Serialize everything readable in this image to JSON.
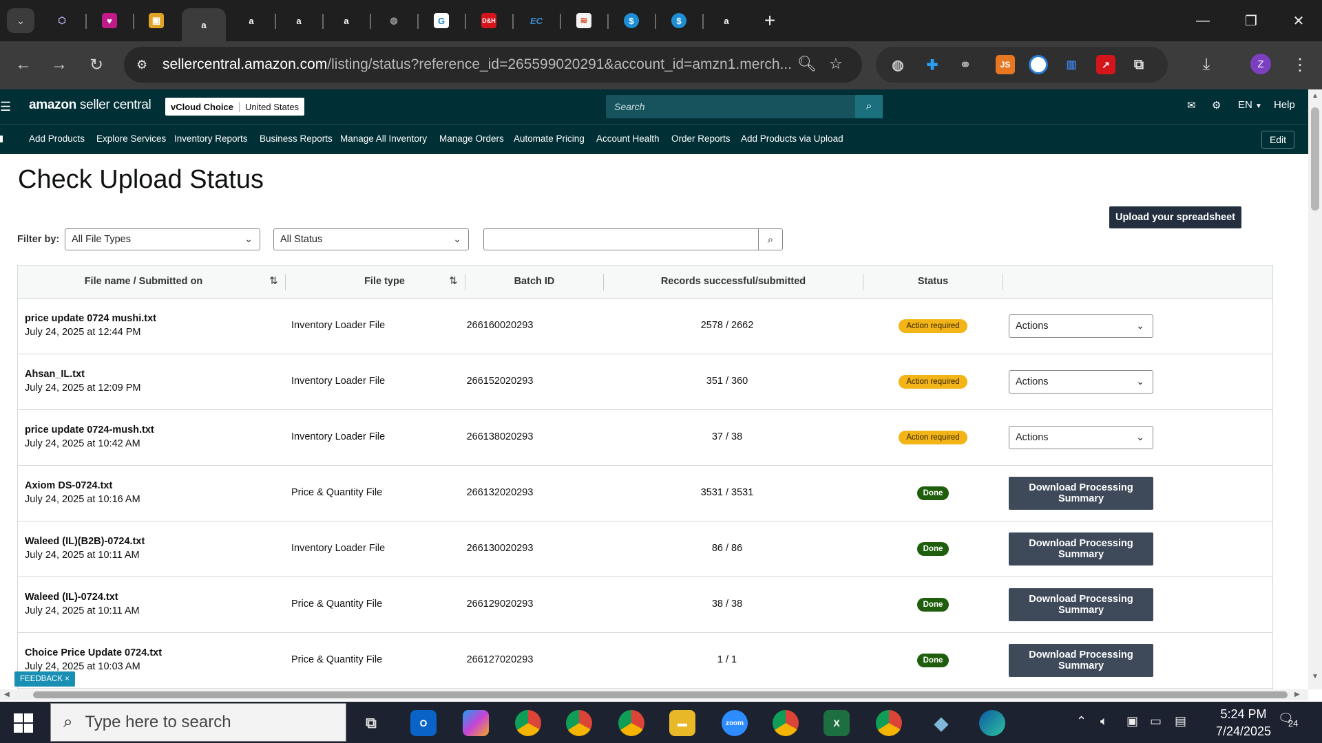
{
  "browser": {
    "url_host": "sellercentral.amazon.com",
    "url_rest": "/listing/status?reference_id=265599020291&account_id=amzn1.merch...",
    "profile_initial": "Z"
  },
  "header": {
    "logo_bold": "amazon",
    "logo_rest": " seller central",
    "store": "vCloud Choice",
    "marketplace": "United States",
    "search_placeholder": "Search",
    "lang": "EN",
    "help": "Help"
  },
  "nav": {
    "items": [
      "Add Products",
      "Explore Services",
      "Inventory Reports",
      "Business Reports",
      "Manage All Inventory",
      "Manage Orders",
      "Automate Pricing",
      "Account Health",
      "Order Reports",
      "Add Products via Upload"
    ],
    "edit": "Edit"
  },
  "page": {
    "title": "Check Upload Status",
    "upload_button": "Upload your spreadsheet",
    "filter_label": "Filter by:",
    "file_type_filter": "All File Types",
    "status_filter": "All Status"
  },
  "table": {
    "headers": [
      "File name / Submitted on",
      "File type",
      "Batch ID",
      "Records successful/submitted",
      "Status"
    ],
    "rows": [
      {
        "name": "price update 0724 mushi.txt",
        "date": "July 24, 2025 at 12:44 PM",
        "type": "Inventory Loader File",
        "batch": "266160020293",
        "records": "2578 / 2662",
        "status": "Action required",
        "action": "Actions"
      },
      {
        "name": "Ahsan_IL.txt",
        "date": "July 24, 2025 at 12:09 PM",
        "type": "Inventory Loader File",
        "batch": "266152020293",
        "records": "351 / 360",
        "status": "Action required",
        "action": "Actions"
      },
      {
        "name": "price update 0724-mush.txt",
        "date": "July 24, 2025 at 10:42 AM",
        "type": "Inventory Loader File",
        "batch": "266138020293",
        "records": "37 / 38",
        "status": "Action required",
        "action": "Actions"
      },
      {
        "name": "Axiom DS-0724.txt",
        "date": "July 24, 2025 at 10:16 AM",
        "type": "Price & Quantity File",
        "batch": "266132020293",
        "records": "3531 / 3531",
        "status": "Done",
        "action": "Download Processing Summary"
      },
      {
        "name": "Waleed (IL)(B2B)-0724.txt",
        "date": "July 24, 2025 at 10:11 AM",
        "type": "Inventory Loader File",
        "batch": "266130020293",
        "records": "86 / 86",
        "status": "Done",
        "action": "Download Processing Summary"
      },
      {
        "name": "Waleed (IL)-0724.txt",
        "date": "July 24, 2025 at 10:11 AM",
        "type": "Price & Quantity File",
        "batch": "266129020293",
        "records": "38 / 38",
        "status": "Done",
        "action": "Download Processing Summary"
      },
      {
        "name": "Choice Price Update 0724.txt",
        "date": "July 24, 2025 at 10:03 AM",
        "type": "Price & Quantity File",
        "batch": "266127020293",
        "records": "1 / 1",
        "status": "Done",
        "action": "Download Processing Summary"
      }
    ]
  },
  "feedback": "FEEDBACK ×",
  "taskbar": {
    "search_placeholder": "Type here to search",
    "time": "5:24 PM",
    "date": "7/24/2025",
    "notifications": "24"
  },
  "colors": {
    "header_bg": "#002f36",
    "action_required": "#f2b416",
    "done": "#1e5e0c",
    "primary_button": "#232f3e"
  }
}
